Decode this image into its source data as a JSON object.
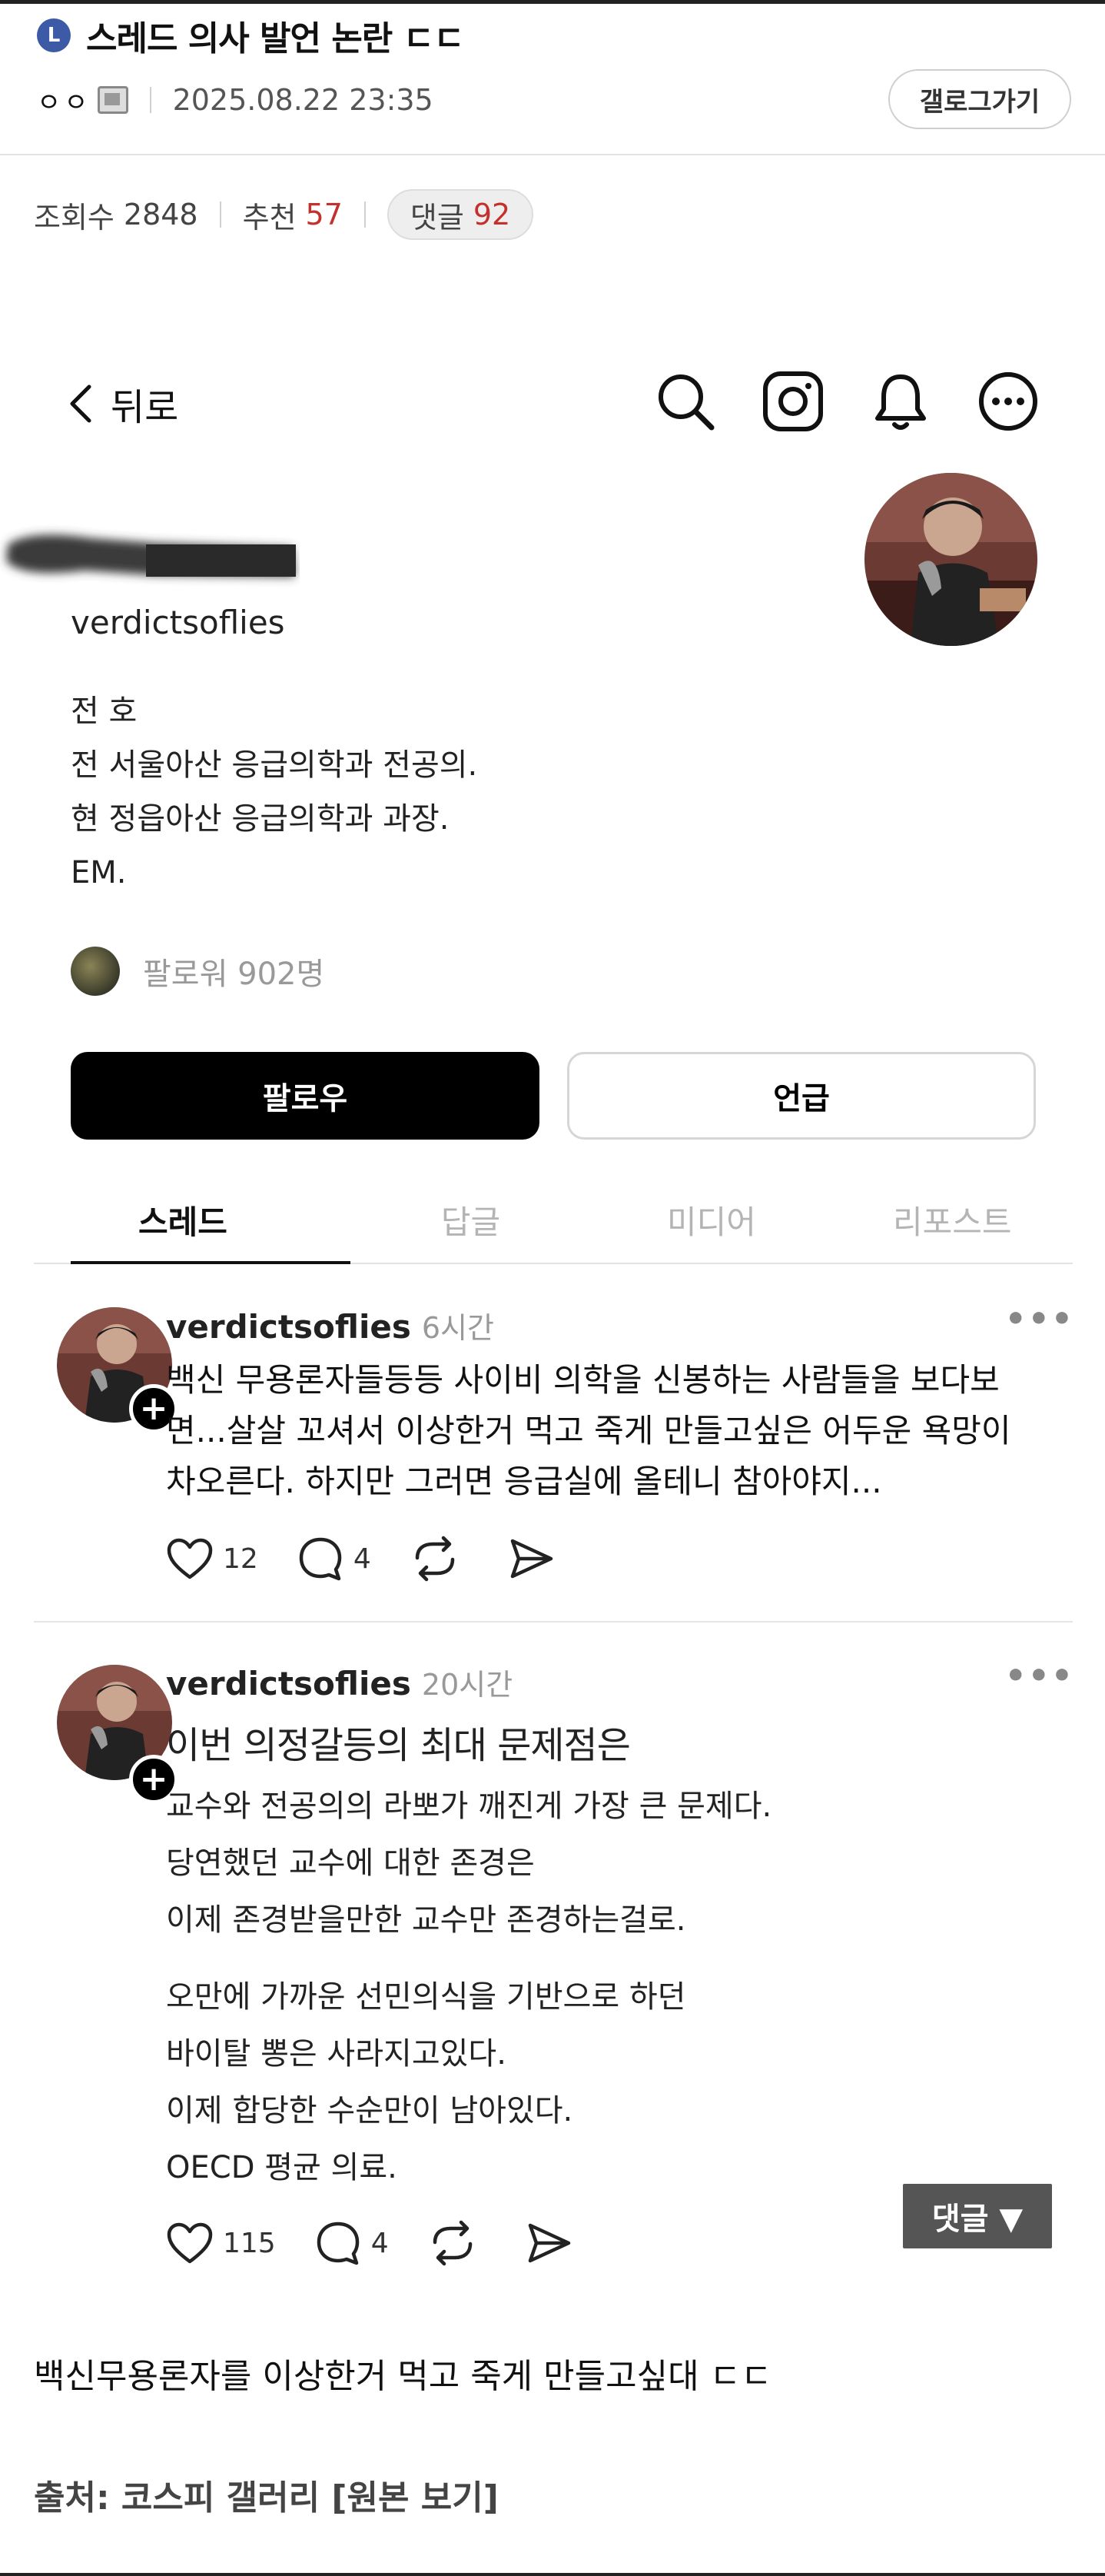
{
  "post": {
    "level_badge": "L",
    "title": "스레드 의사 발언 논란 ㄷㄷ",
    "author": "ㅇㅇ",
    "date": "2025.08.22 23:35",
    "gallery_button": "갤로그가기",
    "stats": {
      "views_label": "조회수",
      "views": "2848",
      "recommend_label": "추천",
      "recommend": "57",
      "comments_label": "댓글",
      "comments": "92"
    }
  },
  "threads": {
    "back_label": "뒤로",
    "icons": [
      "search-icon",
      "instagram-icon",
      "bell-icon",
      "more-circle-icon"
    ],
    "handle": "verdictsoflies",
    "bio_lines": [
      "전 호",
      "전 서울아산 응급의학과 전공의.",
      "현 정읍아산 응급의학과 과장.",
      "EM."
    ],
    "followers": "팔로워 902명",
    "follow_button": "팔로우",
    "mention_button": "언급",
    "tabs": [
      "스레드",
      "답글",
      "미디어",
      "리포스트"
    ],
    "posts": [
      {
        "user": "verdictsoflies",
        "time": "6시간",
        "text": "백신 무용론자들등등 사이비 의학을 신봉하는 사람들을 보다보면...살살 꼬셔서 이상한거 먹고 죽게 만들고싶은 어두운 욕망이 차오른다. 하지만 그러면 응급실에 올테니 참아야지...",
        "likes": "12",
        "replies": "4"
      },
      {
        "user": "verdictsoflies",
        "time": "20시간",
        "heading": "이번 의정갈등의 최대 문제점은",
        "para1": [
          "교수와 전공의의 라뽀가 깨진게 가장 큰 문제다.",
          "당연했던 교수에 대한 존경은",
          "이제 존경받을만한 교수만 존경하는걸로."
        ],
        "para2": [
          "오만에 가까운 선민의식을 기반으로 하던",
          "바이탈 뽕은 사라지고있다.",
          "이제 합당한 수순만이 남아있다.",
          "OECD 평균 의료."
        ],
        "likes": "115",
        "replies": "4"
      }
    ]
  },
  "floating_comment_button": "댓글 ▼",
  "caption": "백신무용론자를 이상한거 먹고 죽게 만들고싶대 ㄷㄷ",
  "source_label": "출처: 코스피 갤러리",
  "source_link": "[원본 보기]"
}
